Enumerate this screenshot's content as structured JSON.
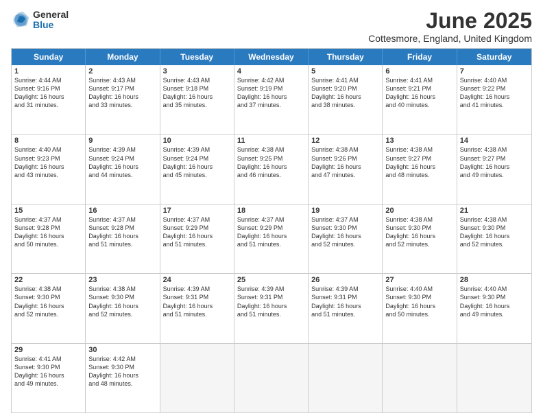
{
  "logo": {
    "general": "General",
    "blue": "Blue"
  },
  "title": "June 2025",
  "subtitle": "Cottesmore, England, United Kingdom",
  "headers": [
    "Sunday",
    "Monday",
    "Tuesday",
    "Wednesday",
    "Thursday",
    "Friday",
    "Saturday"
  ],
  "rows": [
    [
      {
        "day": "1",
        "lines": [
          "Sunrise: 4:44 AM",
          "Sunset: 9:16 PM",
          "Daylight: 16 hours",
          "and 31 minutes."
        ]
      },
      {
        "day": "2",
        "lines": [
          "Sunrise: 4:43 AM",
          "Sunset: 9:17 PM",
          "Daylight: 16 hours",
          "and 33 minutes."
        ]
      },
      {
        "day": "3",
        "lines": [
          "Sunrise: 4:43 AM",
          "Sunset: 9:18 PM",
          "Daylight: 16 hours",
          "and 35 minutes."
        ]
      },
      {
        "day": "4",
        "lines": [
          "Sunrise: 4:42 AM",
          "Sunset: 9:19 PM",
          "Daylight: 16 hours",
          "and 37 minutes."
        ]
      },
      {
        "day": "5",
        "lines": [
          "Sunrise: 4:41 AM",
          "Sunset: 9:20 PM",
          "Daylight: 16 hours",
          "and 38 minutes."
        ]
      },
      {
        "day": "6",
        "lines": [
          "Sunrise: 4:41 AM",
          "Sunset: 9:21 PM",
          "Daylight: 16 hours",
          "and 40 minutes."
        ]
      },
      {
        "day": "7",
        "lines": [
          "Sunrise: 4:40 AM",
          "Sunset: 9:22 PM",
          "Daylight: 16 hours",
          "and 41 minutes."
        ]
      }
    ],
    [
      {
        "day": "8",
        "lines": [
          "Sunrise: 4:40 AM",
          "Sunset: 9:23 PM",
          "Daylight: 16 hours",
          "and 43 minutes."
        ]
      },
      {
        "day": "9",
        "lines": [
          "Sunrise: 4:39 AM",
          "Sunset: 9:24 PM",
          "Daylight: 16 hours",
          "and 44 minutes."
        ]
      },
      {
        "day": "10",
        "lines": [
          "Sunrise: 4:39 AM",
          "Sunset: 9:24 PM",
          "Daylight: 16 hours",
          "and 45 minutes."
        ]
      },
      {
        "day": "11",
        "lines": [
          "Sunrise: 4:38 AM",
          "Sunset: 9:25 PM",
          "Daylight: 16 hours",
          "and 46 minutes."
        ]
      },
      {
        "day": "12",
        "lines": [
          "Sunrise: 4:38 AM",
          "Sunset: 9:26 PM",
          "Daylight: 16 hours",
          "and 47 minutes."
        ]
      },
      {
        "day": "13",
        "lines": [
          "Sunrise: 4:38 AM",
          "Sunset: 9:27 PM",
          "Daylight: 16 hours",
          "and 48 minutes."
        ]
      },
      {
        "day": "14",
        "lines": [
          "Sunrise: 4:38 AM",
          "Sunset: 9:27 PM",
          "Daylight: 16 hours",
          "and 49 minutes."
        ]
      }
    ],
    [
      {
        "day": "15",
        "lines": [
          "Sunrise: 4:37 AM",
          "Sunset: 9:28 PM",
          "Daylight: 16 hours",
          "and 50 minutes."
        ]
      },
      {
        "day": "16",
        "lines": [
          "Sunrise: 4:37 AM",
          "Sunset: 9:28 PM",
          "Daylight: 16 hours",
          "and 51 minutes."
        ]
      },
      {
        "day": "17",
        "lines": [
          "Sunrise: 4:37 AM",
          "Sunset: 9:29 PM",
          "Daylight: 16 hours",
          "and 51 minutes."
        ]
      },
      {
        "day": "18",
        "lines": [
          "Sunrise: 4:37 AM",
          "Sunset: 9:29 PM",
          "Daylight: 16 hours",
          "and 51 minutes."
        ]
      },
      {
        "day": "19",
        "lines": [
          "Sunrise: 4:37 AM",
          "Sunset: 9:30 PM",
          "Daylight: 16 hours",
          "and 52 minutes."
        ]
      },
      {
        "day": "20",
        "lines": [
          "Sunrise: 4:38 AM",
          "Sunset: 9:30 PM",
          "Daylight: 16 hours",
          "and 52 minutes."
        ]
      },
      {
        "day": "21",
        "lines": [
          "Sunrise: 4:38 AM",
          "Sunset: 9:30 PM",
          "Daylight: 16 hours",
          "and 52 minutes."
        ]
      }
    ],
    [
      {
        "day": "22",
        "lines": [
          "Sunrise: 4:38 AM",
          "Sunset: 9:30 PM",
          "Daylight: 16 hours",
          "and 52 minutes."
        ]
      },
      {
        "day": "23",
        "lines": [
          "Sunrise: 4:38 AM",
          "Sunset: 9:30 PM",
          "Daylight: 16 hours",
          "and 52 minutes."
        ]
      },
      {
        "day": "24",
        "lines": [
          "Sunrise: 4:39 AM",
          "Sunset: 9:31 PM",
          "Daylight: 16 hours",
          "and 51 minutes."
        ]
      },
      {
        "day": "25",
        "lines": [
          "Sunrise: 4:39 AM",
          "Sunset: 9:31 PM",
          "Daylight: 16 hours",
          "and 51 minutes."
        ]
      },
      {
        "day": "26",
        "lines": [
          "Sunrise: 4:39 AM",
          "Sunset: 9:31 PM",
          "Daylight: 16 hours",
          "and 51 minutes."
        ]
      },
      {
        "day": "27",
        "lines": [
          "Sunrise: 4:40 AM",
          "Sunset: 9:30 PM",
          "Daylight: 16 hours",
          "and 50 minutes."
        ]
      },
      {
        "day": "28",
        "lines": [
          "Sunrise: 4:40 AM",
          "Sunset: 9:30 PM",
          "Daylight: 16 hours",
          "and 49 minutes."
        ]
      }
    ],
    [
      {
        "day": "29",
        "lines": [
          "Sunrise: 4:41 AM",
          "Sunset: 9:30 PM",
          "Daylight: 16 hours",
          "and 49 minutes."
        ]
      },
      {
        "day": "30",
        "lines": [
          "Sunrise: 4:42 AM",
          "Sunset: 9:30 PM",
          "Daylight: 16 hours",
          "and 48 minutes."
        ]
      },
      {
        "day": "",
        "lines": []
      },
      {
        "day": "",
        "lines": []
      },
      {
        "day": "",
        "lines": []
      },
      {
        "day": "",
        "lines": []
      },
      {
        "day": "",
        "lines": []
      }
    ]
  ]
}
